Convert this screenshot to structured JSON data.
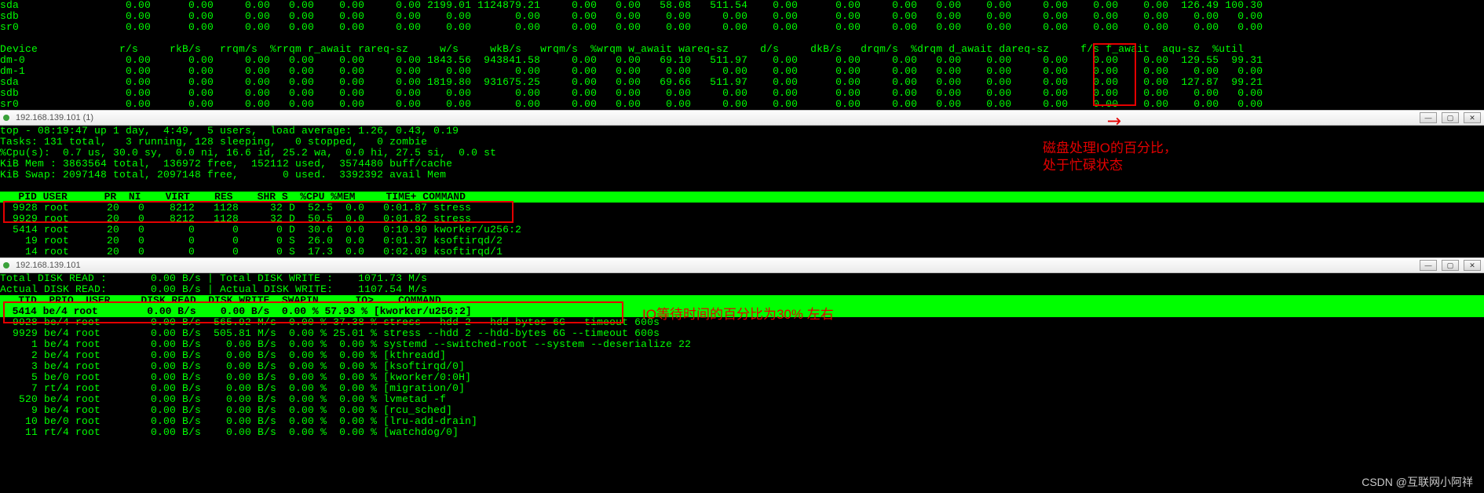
{
  "iostat_top": {
    "rows": [
      {
        "dev": "sda",
        "rs": "0.00",
        "rkbs": "0.00",
        "rrqms": "0.00",
        "pct_rrqm": "0.00",
        "r_await": "0.00",
        "rareq": "0.00",
        "ws": "2199.01",
        "wkbs": "1124879.21",
        "wrqms": "0.00",
        "pct_wrqm": "0.00",
        "w_await": "58.08",
        "wareq": "511.54",
        "ds": "0.00",
        "dkbs": "0.00",
        "drqms": "0.00",
        "pct_drqm": "0.00",
        "d_await": "0.00",
        "dareq": "0.00",
        "fs": "0.00",
        "f_await": "0.00",
        "aqu": "126.49",
        "util": "100.30"
      },
      {
        "dev": "sdb",
        "rs": "0.00",
        "rkbs": "0.00",
        "rrqms": "0.00",
        "pct_rrqm": "0.00",
        "r_await": "0.00",
        "rareq": "0.00",
        "ws": "0.00",
        "wkbs": "0.00",
        "wrqms": "0.00",
        "pct_wrqm": "0.00",
        "w_await": "0.00",
        "wareq": "0.00",
        "ds": "0.00",
        "dkbs": "0.00",
        "drqms": "0.00",
        "pct_drqm": "0.00",
        "d_await": "0.00",
        "dareq": "0.00",
        "fs": "0.00",
        "f_await": "0.00",
        "aqu": "0.00",
        "util": "0.00"
      },
      {
        "dev": "sr0",
        "rs": "0.00",
        "rkbs": "0.00",
        "rrqms": "0.00",
        "pct_rrqm": "0.00",
        "r_await": "0.00",
        "rareq": "0.00",
        "ws": "0.00",
        "wkbs": "0.00",
        "wrqms": "0.00",
        "pct_wrqm": "0.00",
        "w_await": "0.00",
        "wareq": "0.00",
        "ds": "0.00",
        "dkbs": "0.00",
        "drqms": "0.00",
        "pct_drqm": "0.00",
        "d_await": "0.00",
        "dareq": "0.00",
        "fs": "0.00",
        "f_await": "0.00",
        "aqu": "0.00",
        "util": "0.00"
      }
    ]
  },
  "iostat_header": "Device             r/s     rkB/s   rrqm/s  %rrqm r_await rareq-sz     w/s     wkB/s   wrqm/s  %wrqm w_await wareq-sz     d/s     dkB/s   drqm/s  %drqm d_await dareq-sz     f/s f_await  aqu-sz  %util",
  "iostat_block2": {
    "rows": [
      {
        "dev": "dm-0",
        "rs": "0.00",
        "rkbs": "0.00",
        "rrqms": "0.00",
        "pct_rrqm": "0.00",
        "r_await": "0.00",
        "rareq": "0.00",
        "ws": "1843.56",
        "wkbs": "943841.58",
        "wrqms": "0.00",
        "pct_wrqm": "0.00",
        "w_await": "69.10",
        "wareq": "511.97",
        "ds": "0.00",
        "dkbs": "0.00",
        "drqms": "0.00",
        "pct_drqm": "0.00",
        "d_await": "0.00",
        "dareq": "0.00",
        "fs": "0.00",
        "f_await": "0.00",
        "aqu": "129.55",
        "util": "99.31"
      },
      {
        "dev": "dm-1",
        "rs": "0.00",
        "rkbs": "0.00",
        "rrqms": "0.00",
        "pct_rrqm": "0.00",
        "r_await": "0.00",
        "rareq": "0.00",
        "ws": "0.00",
        "wkbs": "0.00",
        "wrqms": "0.00",
        "pct_wrqm": "0.00",
        "w_await": "0.00",
        "wareq": "0.00",
        "ds": "0.00",
        "dkbs": "0.00",
        "drqms": "0.00",
        "pct_drqm": "0.00",
        "d_await": "0.00",
        "dareq": "0.00",
        "fs": "0.00",
        "f_await": "0.00",
        "aqu": "0.00",
        "util": "0.00"
      },
      {
        "dev": "sda",
        "rs": "0.00",
        "rkbs": "0.00",
        "rrqms": "0.00",
        "pct_rrqm": "0.00",
        "r_await": "0.00",
        "rareq": "0.00",
        "ws": "1819.80",
        "wkbs": "931675.25",
        "wrqms": "0.00",
        "pct_wrqm": "0.00",
        "w_await": "69.66",
        "wareq": "511.97",
        "ds": "0.00",
        "dkbs": "0.00",
        "drqms": "0.00",
        "pct_drqm": "0.00",
        "d_await": "0.00",
        "dareq": "0.00",
        "fs": "0.00",
        "f_await": "0.00",
        "aqu": "127.87",
        "util": "99.21"
      },
      {
        "dev": "sdb",
        "rs": "0.00",
        "rkbs": "0.00",
        "rrqms": "0.00",
        "pct_rrqm": "0.00",
        "r_await": "0.00",
        "rareq": "0.00",
        "ws": "0.00",
        "wkbs": "0.00",
        "wrqms": "0.00",
        "pct_wrqm": "0.00",
        "w_await": "0.00",
        "wareq": "0.00",
        "ds": "0.00",
        "dkbs": "0.00",
        "drqms": "0.00",
        "pct_drqm": "0.00",
        "d_await": "0.00",
        "dareq": "0.00",
        "fs": "0.00",
        "f_await": "0.00",
        "aqu": "0.00",
        "util": "0.00"
      },
      {
        "dev": "sr0",
        "rs": "0.00",
        "rkbs": "0.00",
        "rrqms": "0.00",
        "pct_rrqm": "0.00",
        "r_await": "0.00",
        "rareq": "0.00",
        "ws": "0.00",
        "wkbs": "0.00",
        "wrqms": "0.00",
        "pct_wrqm": "0.00",
        "w_await": "0.00",
        "wareq": "0.00",
        "ds": "0.00",
        "dkbs": "0.00",
        "drqms": "0.00",
        "pct_drqm": "0.00",
        "d_await": "0.00",
        "dareq": "0.00",
        "fs": "0.00",
        "f_await": "0.00",
        "aqu": "0.00",
        "util": "0.00"
      }
    ]
  },
  "tab1": {
    "title": "192.168.139.101 (1)"
  },
  "tab2": {
    "title": "192.168.139.101"
  },
  "top": {
    "line1": "top - 08:19:47 up 1 day,  4:49,  5 users,  load average: 1.26, 0.43, 0.19",
    "line2": "Tasks: 131 total,   3 running, 128 sleeping,   0 stopped,   0 zombie",
    "line3": "%Cpu(s):  0.7 us, 30.0 sy,  0.0 ni, 16.6 id, 25.2 wa,  0.0 hi, 27.5 si,  0.0 st",
    "line4": "KiB Mem : 3863564 total,  136972 free,  152112 used,  3574480 buff/cache",
    "line5": "KiB Swap: 2097148 total, 2097148 free,       0 used.  3392392 avail Mem",
    "header": "   PID USER      PR  NI    VIRT    RES    SHR S  %CPU %MEM     TIME+ COMMAND                                                                                                                                                                                   ",
    "rows": [
      "  9928 root      20   0    8212   1128     32 D  52.5  0.0   0:01.87 stress",
      "  9929 root      20   0    8212   1128     32 D  50.5  0.0   0:01.82 stress",
      "  5414 root      20   0       0      0      0 D  30.6  0.0   0:10.90 kworker/u256:2",
      "    19 root      20   0       0      0      0 S  26.0  0.0   0:01.37 ksoftirqd/2",
      "    14 root      20   0       0      0      0 S  17.3  0.0   0:02.09 ksoftirqd/1"
    ]
  },
  "iotop": {
    "line1": "Total DISK READ :       0.00 B/s | Total DISK WRITE :    1071.73 M/s",
    "line2": "Actual DISK READ:       0.00 B/s | Actual DISK WRITE:    1107.54 M/s",
    "header": "   TID  PRIO  USER     DISK READ  DISK WRITE  SWAPIN      IO>    COMMAND                                                                                                                                                                                          ",
    "row_sel": "  5414 be/4 root        0.00 B/s    0.00 B/s  0.00 % 57.93 % [kworker/u256:2]",
    "rows": [
      "  9928 be/4 root        0.00 B/s  565.92 M/s  0.00 % 37.38 % stress --hdd 2 --hdd-bytes 6G --timeout 600s",
      "  9929 be/4 root        0.00 B/s  505.81 M/s  0.00 % 25.01 % stress --hdd 2 --hdd-bytes 6G --timeout 600s",
      "     1 be/4 root        0.00 B/s    0.00 B/s  0.00 %  0.00 % systemd --switched-root --system --deserialize 22",
      "     2 be/4 root        0.00 B/s    0.00 B/s  0.00 %  0.00 % [kthreadd]",
      "     3 be/4 root        0.00 B/s    0.00 B/s  0.00 %  0.00 % [ksoftirqd/0]",
      "     5 be/0 root        0.00 B/s    0.00 B/s  0.00 %  0.00 % [kworker/0:0H]",
      "     7 rt/4 root        0.00 B/s    0.00 B/s  0.00 %  0.00 % [migration/0]",
      "   520 be/4 root        0.00 B/s    0.00 B/s  0.00 %  0.00 % lvmetad -f",
      "     9 be/4 root        0.00 B/s    0.00 B/s  0.00 %  0.00 % [rcu_sched]",
      "    10 be/0 root        0.00 B/s    0.00 B/s  0.00 %  0.00 % [lru-add-drain]",
      "    11 rt/4 root        0.00 B/s    0.00 B/s  0.00 %  0.00 % [watchdog/0]"
    ]
  },
  "annot": {
    "a1_line1": "磁盘处理IO的百分比，",
    "a1_line2": "处于忙碌状态",
    "a2": "IO等待时间的百分比为30% 左右"
  },
  "watermark": "CSDN @互联网小阿祥"
}
